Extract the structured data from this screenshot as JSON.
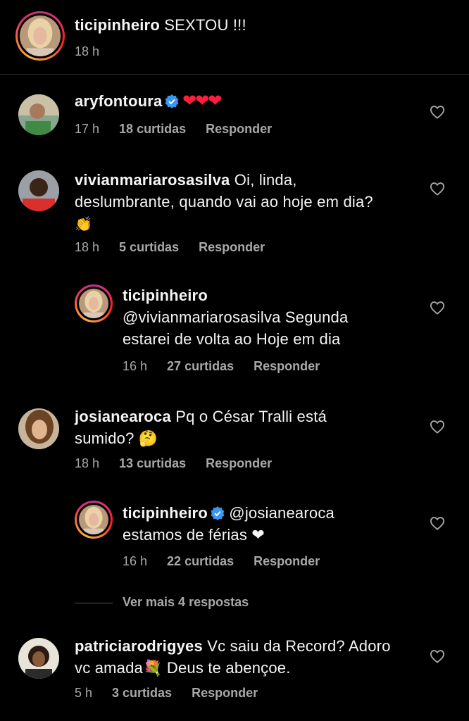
{
  "caption": {
    "username": "ticipinheiro",
    "text": " SEXTOU !!!",
    "time": "18 h"
  },
  "comments": [
    {
      "username": "aryfontoura",
      "verified": true,
      "text": " ❤❤❤",
      "time": "17 h",
      "likes": "18 curtidas",
      "reply": "Responder"
    },
    {
      "username": "vivianmariarosasilva",
      "text_line1": " Oi, linda,",
      "text_line2": "deslumbrante, quando vai ao hoje em dia?",
      "text_line3": "👏",
      "time": "18 h",
      "likes": "5 curtidas",
      "reply": "Responder"
    },
    {
      "username": "ticipinheiro",
      "text_line1": "@vivianmariarosasilva Segunda",
      "text_line2": "estarei de volta ao Hoje em dia",
      "time": "16 h",
      "likes": "27 curtidas",
      "reply": "Responder"
    },
    {
      "username": "josianearoca",
      "text_line1": " Pq o César Tralli está",
      "text_line2": "sumido? 🤔",
      "time": "18 h",
      "likes": "13 curtidas",
      "reply": "Responder"
    },
    {
      "username": "ticipinheiro",
      "verified": true,
      "mention": " @josianearoca",
      "text_line2": "estamos de férias ❤",
      "time": "16 h",
      "likes": "22 curtidas",
      "reply": "Responder"
    },
    {
      "username": "patriciarodrigyes",
      "text_line1": " Vc saiu da Record? Adoro",
      "text_line2": "vc amada💐 Deus te abençoe.",
      "time": "5 h",
      "likes": "3 curtidas",
      "reply": "Responder"
    }
  ],
  "view_more": "Ver mais 4 respostas",
  "colors": {
    "background": "#000000",
    "text": "#f5f5f5",
    "secondary": "#a8a8a8",
    "verified": "#3897f0",
    "heart": "#ff1f3a"
  }
}
